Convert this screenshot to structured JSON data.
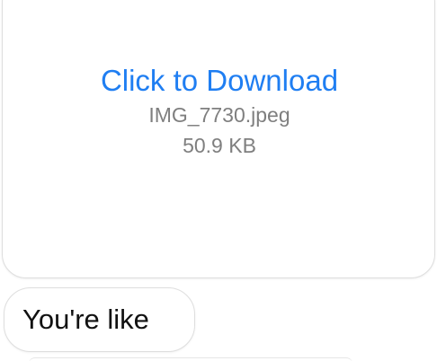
{
  "attachment": {
    "download_label": "Click to Download",
    "file_name": "IMG_7730.jpeg",
    "file_size": "50.9 KB"
  },
  "message": {
    "text": "You're like"
  }
}
